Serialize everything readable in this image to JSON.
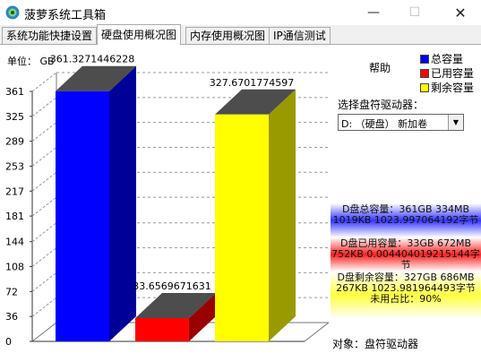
{
  "window": {
    "title": "菠萝系统工具箱",
    "minimize": "—",
    "maximize": "☐",
    "close": "✕"
  },
  "tabs": [
    "系统功能快捷设置",
    "硬盘使用概况图",
    "内存使用概况图",
    "IP通信测试"
  ],
  "active_tab": 1,
  "unit_label": "单位： GB",
  "help": "帮助",
  "legend": [
    {
      "label": "总容量",
      "color": "#0000ff"
    },
    {
      "label": "已用容量",
      "color": "#ff0000"
    },
    {
      "label": "剩余容量",
      "color": "#ffff00"
    }
  ],
  "drive_select": {
    "label": "选择盘符驱动器：",
    "value": "D:  （硬盘）  新加卷"
  },
  "info": {
    "total_1": "D盘总容量：361GB 334MB",
    "total_2": "1019KB 1023.997064192字节",
    "used_1": "D盘已用容量：33GB 672MB",
    "used_2": "752KB 0.004404019215144字节",
    "free_1": "D盘剩余容量：327GB 686MB",
    "free_2": "267KB 1023.981964493字节",
    "free_3": "未用占比：90%"
  },
  "object_label": "对象：盘符驱动器",
  "chart_data": {
    "type": "bar",
    "categories": [
      "总容量",
      "已用容量",
      "剩余容量"
    ],
    "values": [
      361.3271446228,
      33.6569671631,
      327.6701774597
    ],
    "value_labels": [
      "361.3271446228",
      "33.6569671631",
      "327.6701774597"
    ],
    "colors": [
      "#0000ff",
      "#ff0000",
      "#ffff00"
    ],
    "yticks": [
      0,
      36,
      72,
      108,
      144,
      181,
      217,
      253,
      289,
      325,
      361
    ],
    "ylim": [
      0,
      361
    ],
    "grid": true,
    "ylabel": "单位： GB"
  }
}
